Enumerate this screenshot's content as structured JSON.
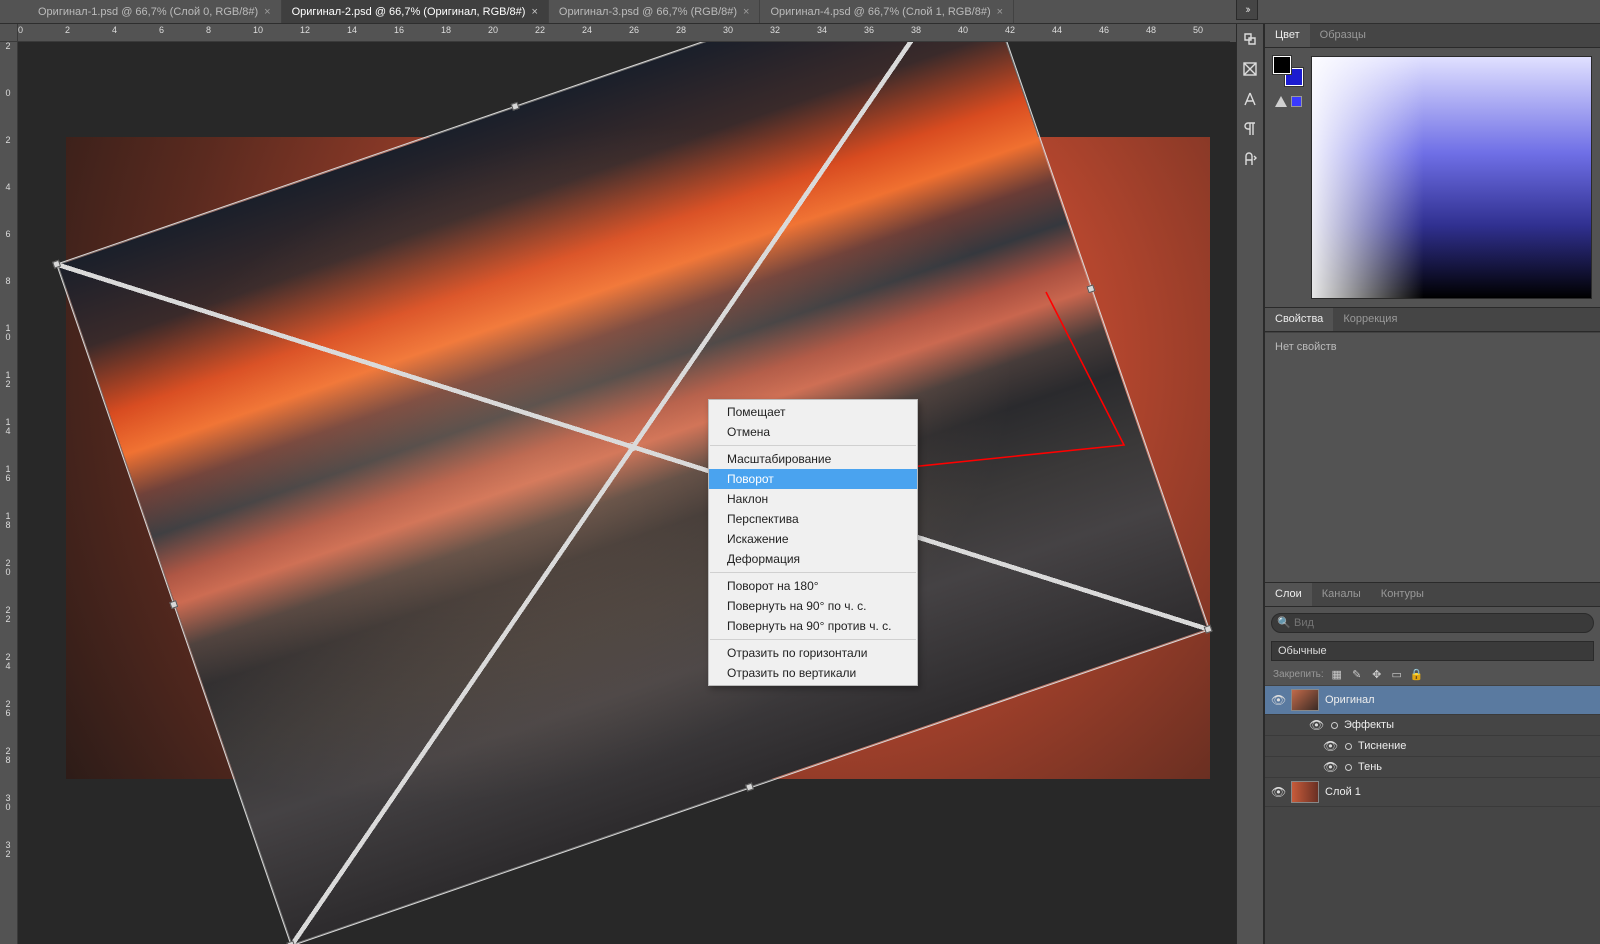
{
  "tabs": [
    {
      "label": "Оригинал-1.psd @ 66,7% (Слой 0, RGB/8#)",
      "active": false
    },
    {
      "label": "Оригинал-2.psd @ 66,7% (Оригинал, RGB/8#)",
      "active": true
    },
    {
      "label": "Оригинал-3.psd @ 66,7% (RGB/8#)",
      "active": false
    },
    {
      "label": "Оригинал-4.psd @ 66,7% (Слой 1, RGB/8#)",
      "active": false
    }
  ],
  "hruler": [
    "0",
    "2",
    "4",
    "6",
    "8",
    "10",
    "12",
    "14",
    "16",
    "18",
    "20",
    "22",
    "24",
    "26",
    "28",
    "30",
    "32",
    "34",
    "36",
    "38",
    "40",
    "42",
    "44",
    "46",
    "48",
    "50"
  ],
  "vruler": [
    "2",
    "0",
    "2",
    "4",
    "6",
    "8",
    "10",
    "12",
    "14",
    "16",
    "18",
    "20",
    "22",
    "24",
    "26",
    "28",
    "30",
    "32"
  ],
  "context": {
    "items": [
      {
        "label": "Помещает",
        "type": "item"
      },
      {
        "label": "Отмена",
        "type": "item"
      },
      {
        "type": "sep"
      },
      {
        "label": "Масштабирование",
        "type": "item"
      },
      {
        "label": "Поворот",
        "type": "item",
        "hl": true
      },
      {
        "label": "Наклон",
        "type": "item"
      },
      {
        "label": "Перспектива",
        "type": "item"
      },
      {
        "label": "Искажение",
        "type": "item"
      },
      {
        "label": "Деформация",
        "type": "item"
      },
      {
        "type": "sep"
      },
      {
        "label": "Поворот на 180°",
        "type": "item"
      },
      {
        "label": "Повернуть на 90° по ч. с.",
        "type": "item"
      },
      {
        "label": "Повернуть на 90° против ч. с.",
        "type": "item"
      },
      {
        "type": "sep"
      },
      {
        "label": "Отразить по горизонтали",
        "type": "item"
      },
      {
        "label": "Отразить по вертикали",
        "type": "item"
      }
    ]
  },
  "panel_color": {
    "tabs": [
      "Цвет",
      "Образцы"
    ],
    "active": 0
  },
  "panel_props": {
    "tabs": [
      "Свойства",
      "Коррекция"
    ],
    "active": 0,
    "body": "Нет свойств"
  },
  "panel_layers": {
    "tabs": [
      "Слои",
      "Каналы",
      "Контуры"
    ],
    "active": 0,
    "search_placeholder": "Вид",
    "blend": "Обычные",
    "lock_label": "Закрепить:"
  },
  "layers": [
    {
      "name": "Оригинал",
      "sel": true,
      "thumb": "photo"
    },
    {
      "name": "Эффекты",
      "sub": 1
    },
    {
      "name": "Тиснение",
      "sub": 2
    },
    {
      "name": "Тень",
      "sub": 2
    },
    {
      "name": "Слой 1",
      "thumb": "grad"
    }
  ]
}
